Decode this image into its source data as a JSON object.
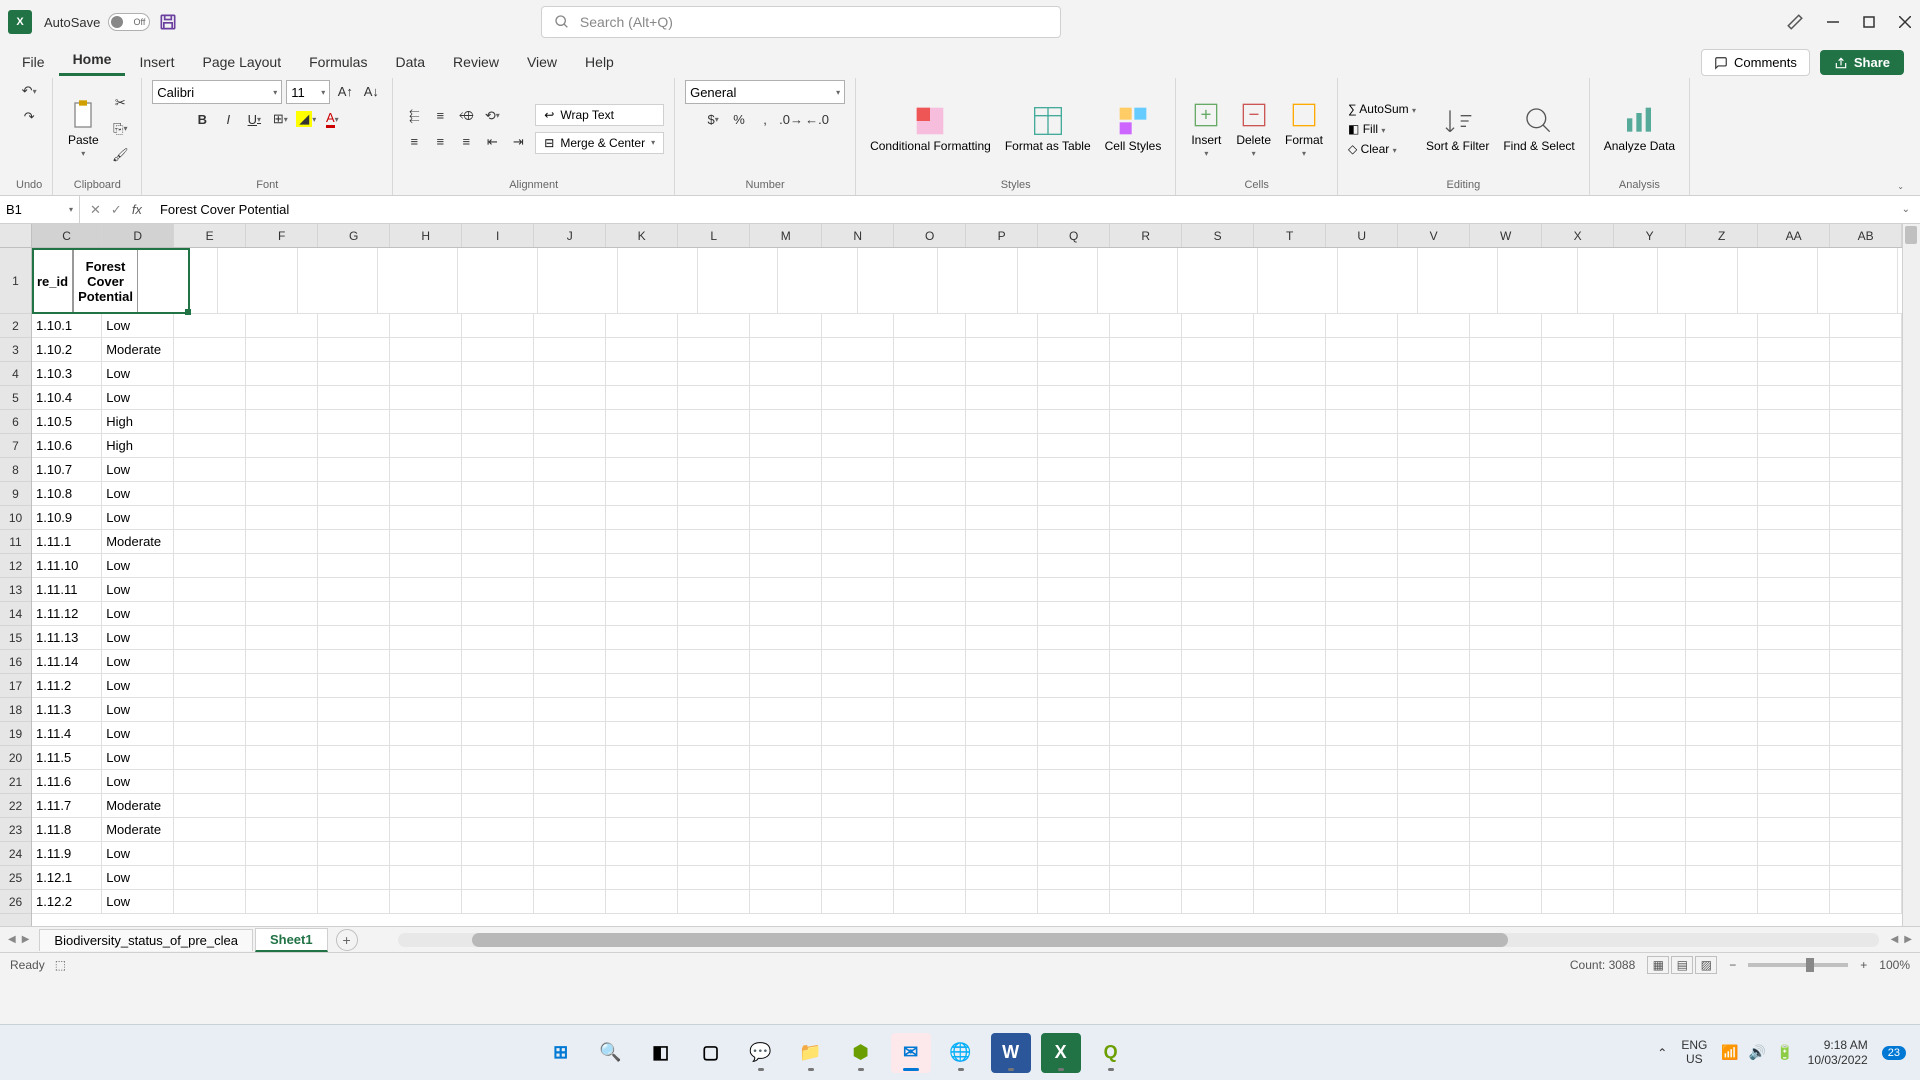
{
  "titlebar": {
    "autosave_label": "AutoSave",
    "autosave_state": "Off",
    "search_placeholder": "Search (Alt+Q)"
  },
  "tabs": {
    "file": "File",
    "home": "Home",
    "insert": "Insert",
    "page_layout": "Page Layout",
    "formulas": "Formulas",
    "data": "Data",
    "review": "Review",
    "view": "View",
    "help": "Help",
    "comments": "Comments",
    "share": "Share"
  },
  "ribbon": {
    "undo": "Undo",
    "paste": "Paste",
    "clipboard": "Clipboard",
    "font_name": "Calibri",
    "font_size": "11",
    "font": "Font",
    "alignment": "Alignment",
    "wrap_text": "Wrap Text",
    "merge_center": "Merge & Center",
    "number_format": "General",
    "number": "Number",
    "cond_fmt": "Conditional Formatting",
    "fmt_table": "Format as Table",
    "cell_styles": "Cell Styles",
    "styles": "Styles",
    "insert_btn": "Insert",
    "delete_btn": "Delete",
    "format_btn": "Format",
    "cells": "Cells",
    "autosum": "AutoSum",
    "fill": "Fill",
    "clear": "Clear",
    "editing": "Editing",
    "sort_filter": "Sort & Filter",
    "find_select": "Find & Select",
    "analyze": "Analyze Data",
    "analysis": "Analysis"
  },
  "formula_bar": {
    "name_box": "B1",
    "formula": "Forest Cover Potential"
  },
  "columns": [
    "C",
    "D",
    "E",
    "F",
    "G",
    "H",
    "I",
    "J",
    "K",
    "L",
    "M",
    "N",
    "O",
    "P",
    "Q",
    "R",
    "S",
    "T",
    "U",
    "V",
    "W",
    "X",
    "Y",
    "Z",
    "AA",
    "AB"
  ],
  "col_widths": {
    "C": 78,
    "D": 80,
    "default": 80
  },
  "headers": {
    "col1": "re_id",
    "col2": "Forest Cover Potential"
  },
  "rows": [
    {
      "n": 2,
      "id": "1.10.1",
      "v": "Low"
    },
    {
      "n": 3,
      "id": "1.10.2",
      "v": "Moderate"
    },
    {
      "n": 4,
      "id": "1.10.3",
      "v": "Low"
    },
    {
      "n": 5,
      "id": "1.10.4",
      "v": "Low"
    },
    {
      "n": 6,
      "id": "1.10.5",
      "v": "High"
    },
    {
      "n": 7,
      "id": "1.10.6",
      "v": "High"
    },
    {
      "n": 8,
      "id": "1.10.7",
      "v": "Low"
    },
    {
      "n": 9,
      "id": "1.10.8",
      "v": "Low"
    },
    {
      "n": 10,
      "id": "1.10.9",
      "v": "Low"
    },
    {
      "n": 11,
      "id": "1.11.1",
      "v": "Moderate"
    },
    {
      "n": 12,
      "id": "1.11.10",
      "v": "Low"
    },
    {
      "n": 13,
      "id": "1.11.11",
      "v": "Low"
    },
    {
      "n": 14,
      "id": "1.11.12",
      "v": "Low"
    },
    {
      "n": 15,
      "id": "1.11.13",
      "v": "Low"
    },
    {
      "n": 16,
      "id": "1.11.14",
      "v": "Low"
    },
    {
      "n": 17,
      "id": "1.11.2",
      "v": "Low"
    },
    {
      "n": 18,
      "id": "1.11.3",
      "v": "Low"
    },
    {
      "n": 19,
      "id": "1.11.4",
      "v": "Low"
    },
    {
      "n": 20,
      "id": "1.11.5",
      "v": "Low"
    },
    {
      "n": 21,
      "id": "1.11.6",
      "v": "Low"
    },
    {
      "n": 22,
      "id": "1.11.7",
      "v": "Moderate"
    },
    {
      "n": 23,
      "id": "1.11.8",
      "v": "Moderate"
    },
    {
      "n": 24,
      "id": "1.11.9",
      "v": "Low"
    },
    {
      "n": 25,
      "id": "1.12.1",
      "v": "Low"
    },
    {
      "n": 26,
      "id": "1.12.2",
      "v": "Low"
    }
  ],
  "sheets": {
    "tab1": "Biodiversity_status_of_pre_clea",
    "tab2": "Sheet1"
  },
  "status": {
    "ready": "Ready",
    "count": "Count: 3088",
    "zoom": "100%"
  },
  "taskbar": {
    "lang1": "ENG",
    "lang2": "US",
    "time": "9:18 AM",
    "date": "10/03/2022",
    "notif": "23"
  }
}
